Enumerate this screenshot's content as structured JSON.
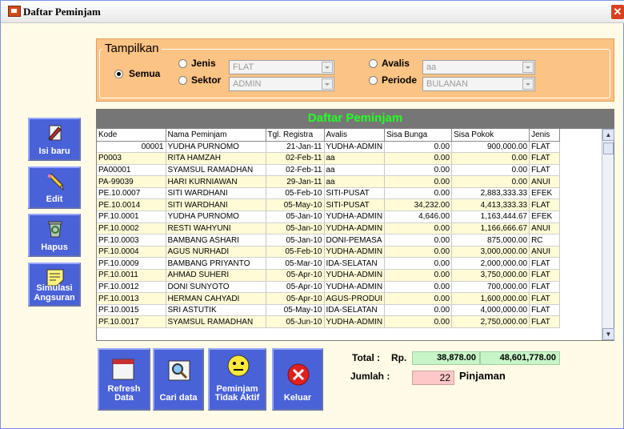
{
  "window": {
    "title": "Daftar Peminjam",
    "close_label": "✕"
  },
  "filter": {
    "legend": "Tampilkan",
    "semua_label": "Semua",
    "jenis_label": "Jenis",
    "jenis_value": "FLAT",
    "sektor_label": "Sektor",
    "sektor_value": "ADMIN",
    "avalis_label": "Avalis",
    "avalis_value": "aa",
    "periode_label": "Periode",
    "periode_value": "BULANAN",
    "selected": "semua"
  },
  "grid": {
    "title": "Daftar Peminjam",
    "columns": [
      "Kode",
      "Nama Peminjam",
      "Tgl. Registra",
      "Avalis",
      "Sisa Bunga",
      "Sisa Pokok",
      "Jenis"
    ],
    "rows": [
      [
        "00001",
        "YUDHA PURNOMO",
        "21-Jan-11",
        "YUDHA-ADMIN",
        "0.00",
        "900,000.00",
        "FLAT"
      ],
      [
        "P0003",
        "RITA HAMZAH",
        "02-Feb-11",
        "aa",
        "0.00",
        "0.00",
        "FLAT"
      ],
      [
        "PA00001",
        "SYAMSUL RAMADHAN",
        "02-Feb-11",
        "aa",
        "0.00",
        "0.00",
        "FLAT"
      ],
      [
        "PA-99039",
        "HARI KURNIAWAN",
        "29-Jan-11",
        "aa",
        "0.00",
        "0.00",
        "ANUI"
      ],
      [
        "PE.10.0007",
        "SITI WARDHANI",
        "05-Feb-10",
        "SITI-PUSAT",
        "0.00",
        "2,883,333.33",
        "EFEK"
      ],
      [
        "PE.10.0014",
        "SITI WARDHANI",
        "05-May-10",
        "SITI-PUSAT",
        "34,232.00",
        "4,413,333.33",
        "FLAT"
      ],
      [
        "PF.10.0001",
        "YUDHA PURNOMO",
        "05-Jan-10",
        "YUDHA-ADMIN",
        "4,646.00",
        "1,163,444.67",
        "EFEK"
      ],
      [
        "PF.10.0002",
        "RESTI WAHYUNI",
        "05-Jan-10",
        "YUDHA-ADMIN",
        "0.00",
        "1,166,666.67",
        "ANUI"
      ],
      [
        "PF.10.0003",
        "BAMBANG ASHARI",
        "05-Jan-10",
        "DONI-PEMASA",
        "0.00",
        "875,000.00",
        "RC"
      ],
      [
        "PF.10.0004",
        "AGUS NURHADI",
        "05-Feb-10",
        "YUDHA-ADMIN",
        "0.00",
        "3,000,000.00",
        "ANUI"
      ],
      [
        "PF.10.0009",
        "BAMBANG PRIYANTO",
        "05-Mar-10",
        "IDA-SELATAN",
        "0.00",
        "2,000,000.00",
        "FLAT"
      ],
      [
        "PF.10.0011",
        "AHMAD SUHERI",
        "05-Apr-10",
        "YUDHA-ADMIN",
        "0.00",
        "3,750,000.00",
        "FLAT"
      ],
      [
        "PF.10.0012",
        "DONI SUNYOTO",
        "05-Apr-10",
        "YUDHA-ADMIN",
        "0.00",
        "700,000.00",
        "FLAT"
      ],
      [
        "PF.10.0013",
        "HERMAN CAHYADI",
        "05-Apr-10",
        "AGUS-PRODUI",
        "0.00",
        "1,600,000.00",
        "FLAT"
      ],
      [
        "PF.10.0015",
        "SRI ASTUTIK",
        "05-May-10",
        "IDA-SELATAN",
        "0.00",
        "4,000,000.00",
        "FLAT"
      ],
      [
        "PF.10.0017",
        "SYAMSUL RAMADHAN",
        "05-Jun-10",
        "YUDHA-ADMIN",
        "0.00",
        "2,750,000.00",
        "FLAT"
      ]
    ]
  },
  "side_buttons": {
    "isi_baru": "Isi baru",
    "edit": "Edit",
    "hapus": "Hapus",
    "simulasi_1": "Simulasi",
    "simulasi_2": "Angsuran"
  },
  "bottom_buttons": {
    "refresh_1": "Refresh",
    "refresh_2": "Data",
    "cari": "Cari data",
    "peminjam_1": "Peminjam",
    "peminjam_2": "Tidak Aktif",
    "keluar": "Keluar"
  },
  "totals": {
    "total_label": "Total :",
    "rp_label": "Rp.",
    "sisa_bunga_total": "38,878.00",
    "sisa_pokok_total": "48,601,778.00",
    "jumlah_label": "Jumlah :",
    "jumlah_value": "22",
    "jumlah_unit": "Pinjaman"
  }
}
